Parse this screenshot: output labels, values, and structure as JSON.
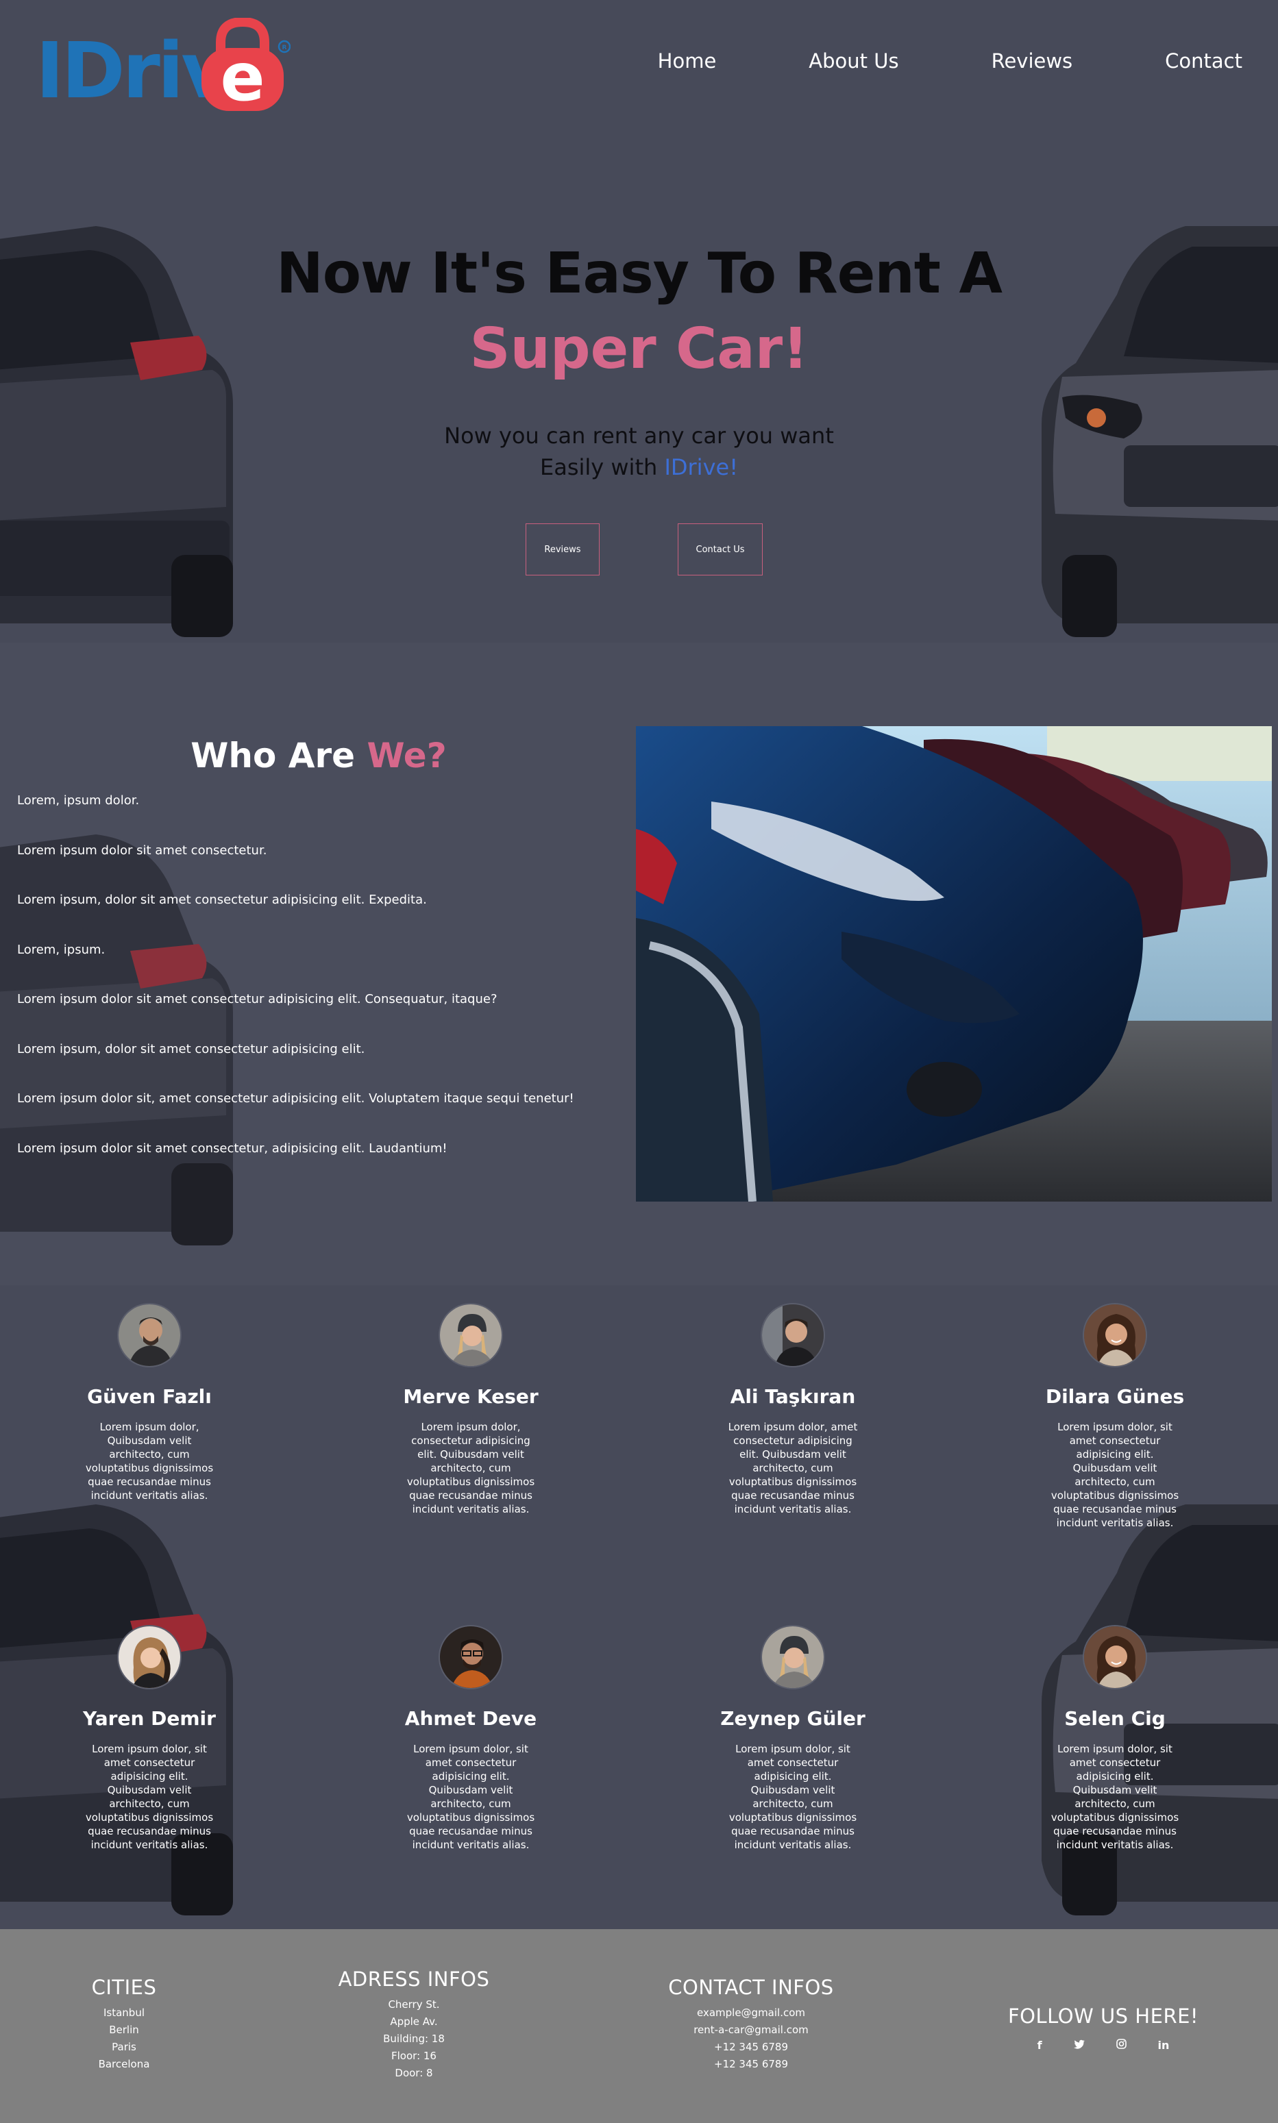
{
  "brand": {
    "logo_text": "IDriv",
    "logo_letter": "e",
    "registered_mark": "®",
    "colors": {
      "blue": "#1f73b7",
      "red": "#e8434b"
    }
  },
  "nav": {
    "items": [
      {
        "label": "Home"
      },
      {
        "label": "About Us"
      },
      {
        "label": "Reviews"
      },
      {
        "label": "Contact"
      }
    ]
  },
  "hero": {
    "title": "Now It's Easy To Rent A",
    "accent": "Super Car!",
    "subtitle_1": "Now you can rent any car you want",
    "subtitle_2_prefix": "Easily with ",
    "subtitle_2_brand": "IDrive!",
    "buttons": {
      "reviews": "Reviews",
      "contact": "Contact Us"
    },
    "accent_color": "#d6688b"
  },
  "who": {
    "title_prefix": "Who Are ",
    "title_accent": "We?",
    "lines": [
      "Lorem, ipsum dolor.",
      "Lorem ipsum dolor sit amet consectetur.",
      "Lorem ipsum, dolor sit amet consectetur adipisicing elit. Expedita.",
      "Lorem, ipsum.",
      "Lorem ipsum dolor sit amet consectetur adipisicing elit. Consequatur, itaque?",
      "Lorem ipsum, dolor sit amet consectetur adipisicing elit.",
      "Lorem ipsum dolor sit, amet consectetur adipisicing elit. Voluptatem itaque sequi tenetur!",
      "Lorem ipsum dolor sit amet consectetur, adipisicing elit. Laudantium!"
    ]
  },
  "team": {
    "members": [
      {
        "name": "Güven Fazlı",
        "bio": "Lorem ipsum dolor, Quibusdam velit architecto, cum voluptatibus dignissimos quae recusandae minus incidunt veritatis alias."
      },
      {
        "name": "Merve Keser",
        "bio": "Lorem ipsum dolor, consectetur adipisicing elit. Quibusdam velit architecto, cum voluptatibus dignissimos quae recusandae minus incidunt veritatis alias."
      },
      {
        "name": "Ali Taşkıran",
        "bio": "Lorem ipsum dolor, amet consectetur adipisicing elit. Quibusdam velit architecto, cum voluptatibus dignissimos quae recusandae minus incidunt veritatis alias."
      },
      {
        "name": "Dilara Günes",
        "bio": "Lorem ipsum dolor, sit amet consectetur adipisicing elit. Quibusdam velit architecto, cum voluptatibus dignissimos quae recusandae minus incidunt veritatis alias."
      },
      {
        "name": "Yaren Demir",
        "bio": "Lorem ipsum dolor, sit amet consectetur adipisicing elit. Quibusdam velit architecto, cum voluptatibus dignissimos quae recusandae minus incidunt veritatis alias."
      },
      {
        "name": "Ahmet Deve",
        "bio": "Lorem ipsum dolor, sit amet consectetur adipisicing elit. Quibusdam velit architecto, cum voluptatibus dignissimos quae recusandae minus incidunt veritatis alias."
      },
      {
        "name": "Zeynep Güler",
        "bio": "Lorem ipsum dolor, sit amet consectetur adipisicing elit. Quibusdam velit architecto, cum voluptatibus dignissimos quae recusandae minus incidunt veritatis alias."
      },
      {
        "name": "Selen Cig",
        "bio": "Lorem ipsum dolor, sit amet consectetur adipisicing elit. Quibusdam velit architecto, cum voluptatibus dignissimos quae recusandae minus incidunt veritatis alias."
      }
    ]
  },
  "footer": {
    "cities": {
      "title": "CITIES",
      "items": [
        "Istanbul",
        "Berlin",
        "Paris",
        "Barcelona"
      ]
    },
    "address": {
      "title": "ADRESS INFOS",
      "items": [
        "Cherry St.",
        "Apple Av.",
        "Building: 18",
        "Floor: 16",
        "Door: 8"
      ]
    },
    "contact": {
      "title": "CONTACT INFOS",
      "items": [
        "example@gmail.com",
        "rent-a-car@gmail.com",
        "+12 345 6789",
        "+12 345 6789"
      ]
    },
    "follow": {
      "title": "FOLLOW US HERE!",
      "icons": [
        {
          "name": "facebook-icon",
          "glyph": "f"
        },
        {
          "name": "twitter-icon",
          "glyph": "t"
        },
        {
          "name": "instagram-icon",
          "glyph": "◎"
        },
        {
          "name": "linkedin-icon",
          "glyph": "in"
        }
      ]
    }
  }
}
